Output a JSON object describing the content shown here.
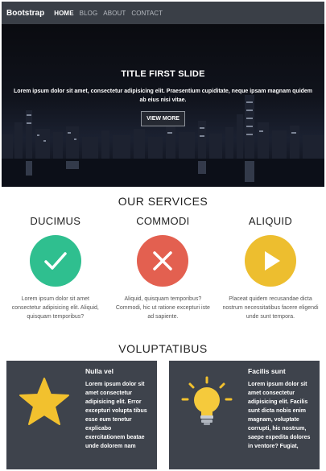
{
  "navbar": {
    "brand": "Bootstrap",
    "links": [
      "HOME",
      "BLOG",
      "ABOUT",
      "CONTACT"
    ]
  },
  "hero": {
    "title": "TITLE FIRST SLIDE",
    "text": "Lorem ipsum dolor sit amet, consectetur adipisicing elit. Praesentium cupiditate, neque ipsam magnam quidem ab eius nisi vitae.",
    "button": "VIEW MORE"
  },
  "services": {
    "title": "OUR SERVICES",
    "items": [
      {
        "title": "DUCIMUS",
        "icon": "checkmark-icon",
        "color": "#2fbf8f",
        "text": "Lorem ipsum dolor sit amet consectetur adipisicing elit. Aliquid, quisquam temporibus?"
      },
      {
        "title": "COMMODI",
        "icon": "close-icon",
        "color": "#e36050",
        "text": "Aliquid, quisquam temporibus? Commodi, hic ut ratione excepturi iste ad sapiente."
      },
      {
        "title": "ALIQUID",
        "icon": "play-icon",
        "color": "#edbe2f",
        "text": "Placeat quidem recusandae dicta nostrum necessitatibus facere eligendi unde sunt tempora."
      }
    ]
  },
  "voluptatibus": {
    "title": "VOLUPTATIBUS",
    "cards": [
      {
        "title": "Nulla vel",
        "icon": "star-icon",
        "text": "Lorem ipsum dolor sit amet consectetur adipisicing elit. Error excepturi volupta tibus esse eum tenetur explicabo exercitationem beatae unde dolorem nam"
      },
      {
        "title": "Facilis sunt",
        "icon": "lightbulb-icon",
        "text": "Lorem ipsum dolor sit amet consectetur adipisicing elit. Facilis sunt dicta nobis enim magnam, voluptate corrupti, hic nostrum, saepe expedita dolores in ventore? Fugiat,"
      }
    ]
  }
}
